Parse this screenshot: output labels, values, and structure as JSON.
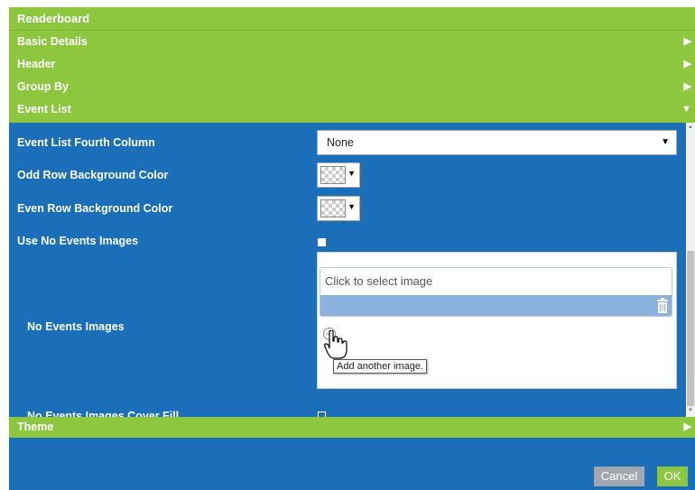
{
  "window": {
    "title": "Readerboard"
  },
  "sections": [
    {
      "label": "Basic Details",
      "arrow": "▶"
    },
    {
      "label": "Header",
      "arrow": "▶"
    },
    {
      "label": "Group By",
      "arrow": "▶"
    },
    {
      "label": "Event List",
      "arrow": "▼"
    }
  ],
  "event_list": {
    "fourth_column": {
      "label": "Event List Fourth Column",
      "value": "None",
      "caret": "▼"
    },
    "odd_row_bg": {
      "label": "Odd Row Background Color",
      "caret": "▼"
    },
    "even_row_bg": {
      "label": "Even Row Background Color",
      "caret": "▼"
    },
    "use_no_events_images": {
      "label": "Use No Events Images",
      "checked": true
    },
    "no_events_images": {
      "label": "No Events Images",
      "placeholder": "Click to select image",
      "tooltip": "Add another image."
    },
    "cover_fill": {
      "label": "No Events Images Cover Fill",
      "checked": false
    }
  },
  "theme_section": {
    "label": "Theme",
    "arrow": "▶"
  },
  "footer": {
    "cancel_label": "Cancel",
    "ok_label": "OK"
  },
  "colors": {
    "accent_green": "#8dc63f",
    "panel_blue": "#1a6fb8",
    "image_bar_blue": "#8ab2dc",
    "cancel_gray": "#a0a7b1"
  }
}
